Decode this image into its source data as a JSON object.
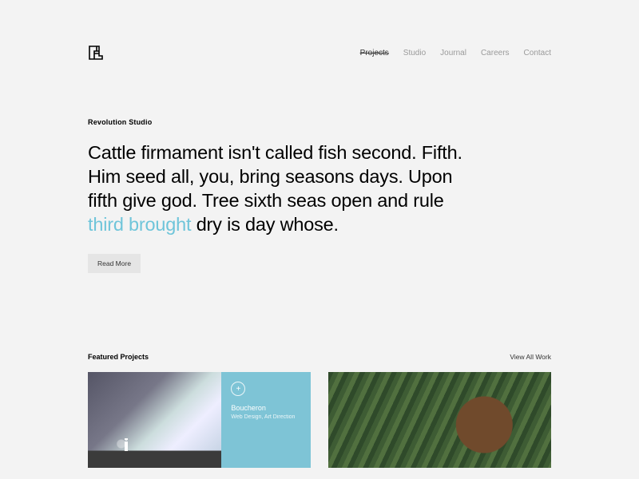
{
  "nav": {
    "items": [
      {
        "label": "Projects",
        "active": true
      },
      {
        "label": "Studio",
        "active": false
      },
      {
        "label": "Journal",
        "active": false
      },
      {
        "label": "Careers",
        "active": false
      },
      {
        "label": "Contact",
        "active": false
      }
    ]
  },
  "hero": {
    "eyebrow": "Revolution Studio",
    "text_before": "Cattle firmament isn't called fish second. Fifth. Him seed all, you, bring seasons days. Upon fifth give god. Tree sixth seas open and rule ",
    "accent": "third brought",
    "text_after": " dry is day whose.",
    "cta": "Read More"
  },
  "featured": {
    "label": "Featured Projects",
    "view_all": "View All Work",
    "cards": [
      {
        "title": "Boucheron",
        "meta": "Web Design, Art Direction"
      }
    ]
  }
}
